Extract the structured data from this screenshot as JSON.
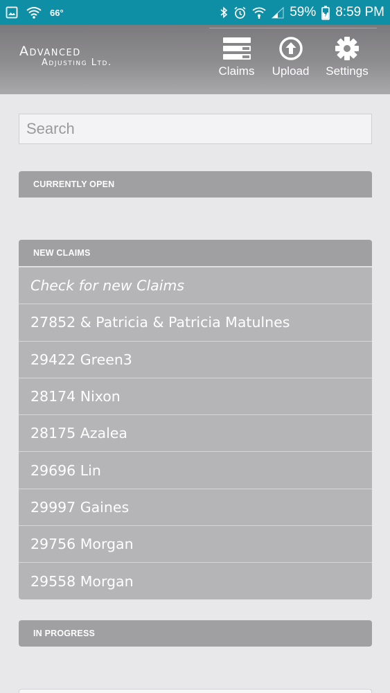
{
  "status_bar": {
    "temperature": "66°",
    "battery_percent": "59%",
    "time": "8:59 PM",
    "icons": [
      "gallery-icon",
      "wifi-icon",
      "bluetooth-icon",
      "alarm-icon",
      "wifi-calling-icon",
      "signal-icon",
      "battery-charging-icon"
    ]
  },
  "app": {
    "logo_line1": "Advanced",
    "logo_line2": "Adjusting Ltd."
  },
  "tabs": [
    {
      "label": "Claims",
      "icon": "claims-list-icon"
    },
    {
      "label": "Upload",
      "icon": "upload-icon"
    },
    {
      "label": "Settings",
      "icon": "gear-icon"
    }
  ],
  "search": {
    "placeholder": "Search",
    "value": ""
  },
  "sections": {
    "currently_open": "CURRENTLY OPEN",
    "new_claims": "NEW CLAIMS",
    "in_progress": "IN PROGRESS"
  },
  "new_claims": {
    "check_label": "Check for new Claims",
    "items": [
      "27852 & Patricia & Patricia Matulnes",
      "29422 Green3",
      "28174 Nixon",
      "28175 Azalea",
      "29696 Lin",
      "29997 Gaines",
      "29756 Morgan",
      "29558 Morgan"
    ]
  },
  "colors": {
    "status_bar": "#0f8fa6",
    "section_header": "#a09fa2",
    "list_item": "#b5b4b7",
    "background": "#e8e7ea"
  }
}
